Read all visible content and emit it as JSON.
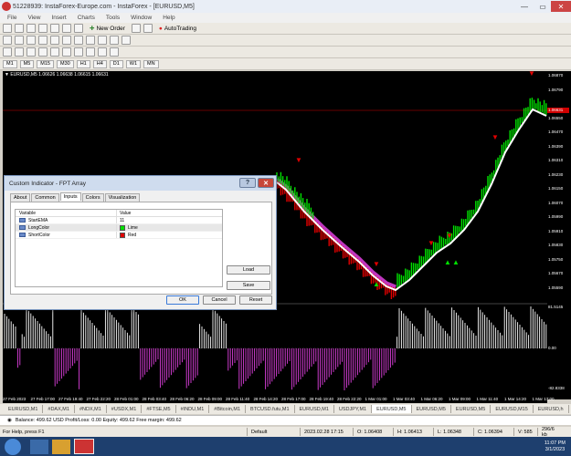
{
  "window": {
    "title": "51228939: InstaForex-Europe.com - InstaForex - [EURUSD,M5]",
    "controls": [
      "—",
      "▭",
      "✕"
    ]
  },
  "menu": [
    "File",
    "View",
    "Insert",
    "Charts",
    "Tools",
    "Window",
    "Help"
  ],
  "toolbar": {
    "new_order": "New Order",
    "autotrading": "AutoTrading",
    "timeframes": [
      "M1",
      "M5",
      "M15",
      "M30",
      "H1",
      "H4",
      "D1",
      "W1",
      "MN"
    ]
  },
  "chart": {
    "header": "▼ EURUSD,M5  1.06626  1.06638  1.06615  1.06631",
    "price_labels": [
      "1.06870",
      "1.06790",
      "1.06631",
      "1.06550",
      "1.06470",
      "1.06390",
      "1.06310",
      "1.06230",
      "1.06150",
      "1.06070",
      "1.05990",
      "1.05910",
      "1.05830",
      "1.05750",
      "1.05670",
      "1.05590"
    ],
    "current_price": "1.06631",
    "indicator_labels": [
      "81.5145",
      "0.00",
      "-82.8338"
    ],
    "time_labels": [
      "27 Feb 2023",
      "27 Feb 17:00",
      "27 Feb 19:40",
      "27 Feb 22:20",
      "28 Feb 01:00",
      "28 Feb 03:40",
      "28 Feb 06:20",
      "28 Feb 09:00",
      "28 Feb 11:40",
      "28 Feb 14:20",
      "28 Feb 17:00",
      "28 Feb 19:40",
      "28 Feb 22:20",
      "1 Mar 01:00",
      "1 Mar 03:40",
      "1 Mar 06:20",
      "1 Mar 09:00",
      "1 Mar 11:40",
      "1 Mar 14:20",
      "1 Mar 17:00"
    ]
  },
  "symbol_tabs": [
    "EURUSD,M1",
    "#DAX,M1",
    "#NDX,M1",
    "#USDX,M1",
    "#FTSE,M5",
    "#INDU,M1",
    "#Bitcoin,M1",
    "BTCUSD.futu,M1",
    "EURUSD,M1",
    "USDJPY,M1",
    "EURUSD,M5",
    "EURUSD,M5",
    "EURUSD,M5",
    "EURUSD,M15",
    "EURUSD,h"
  ],
  "balance": {
    "text": "Balance: 499.62 USD   Profit/Loss: 0.00   Equity: 499.62   Free margin: 499.62"
  },
  "status": {
    "help": "For Help, press F1",
    "profile": "Default",
    "datetime": "2023.02.28 17:15",
    "open": "O: 1.06408",
    "high": "H: 1.06413",
    "low": "L: 1.06348",
    "close": "C: 1.06394",
    "volume": "V: 585",
    "traffic": "296/6 kb"
  },
  "taskbar": {
    "time": "11:07 PM",
    "date": "3/1/2023"
  },
  "dialog": {
    "title": "Custom Indicator - FPT Array",
    "help_button": "?",
    "close_button": "✕",
    "tabs": [
      "About",
      "Common",
      "Inputs",
      "Colors",
      "Visualization"
    ],
    "columns": [
      "Variable",
      "Value"
    ],
    "rows": [
      {
        "var": "StartEMA",
        "val": "11",
        "swatch": ""
      },
      {
        "var": "LongColor",
        "val": "Lime",
        "swatch": "#00e000"
      },
      {
        "var": "ShortColor",
        "val": "Red",
        "swatch": "#e00000"
      }
    ],
    "load_button": "Load",
    "save_button": "Save",
    "ok_button": "OK",
    "cancel_button": "Cancel",
    "reset_button": "Reset"
  },
  "colors": {
    "long": "#00e000",
    "short": "#e00000",
    "histogram_pos": "#ffffff",
    "histogram_neg": "#e040e0",
    "band": "#e040e0",
    "ma": "#ffffff"
  }
}
